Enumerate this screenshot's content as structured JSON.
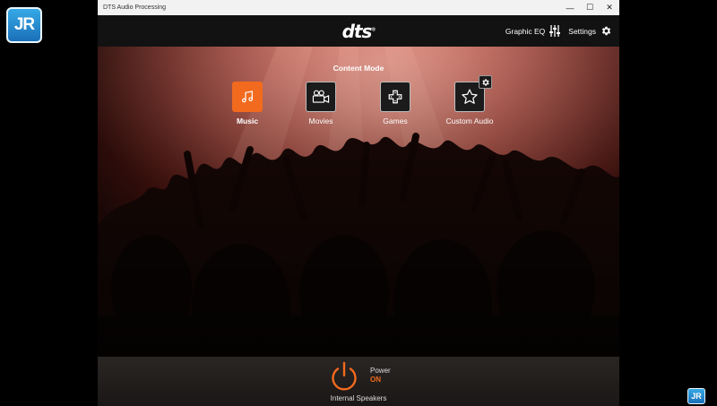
{
  "watermark": {
    "text": "JR",
    "small_text": "JR"
  },
  "window": {
    "title": "DTS Audio Processing",
    "controls": {
      "minimize": "—",
      "maximize": "☐",
      "close": "✕"
    }
  },
  "header": {
    "logo": "dts",
    "logo_mark": "®",
    "graphic_eq_label": "Graphic EQ",
    "settings_label": "Settings"
  },
  "content_mode": {
    "title": "Content Mode",
    "selected": "Music",
    "modes": [
      {
        "label": "Music",
        "icon": "music-note-icon"
      },
      {
        "label": "Movies",
        "icon": "video-camera-icon"
      },
      {
        "label": "Games",
        "icon": "gamepad-icon"
      },
      {
        "label": "Custom Audio",
        "icon": "star-icon"
      }
    ]
  },
  "footer": {
    "power_label": "Power",
    "power_state": "ON",
    "device_label": "Internal Speakers"
  },
  "colors": {
    "accent": "#f26a1e",
    "background": "#111111",
    "titlebar": "#f2f2f2"
  }
}
